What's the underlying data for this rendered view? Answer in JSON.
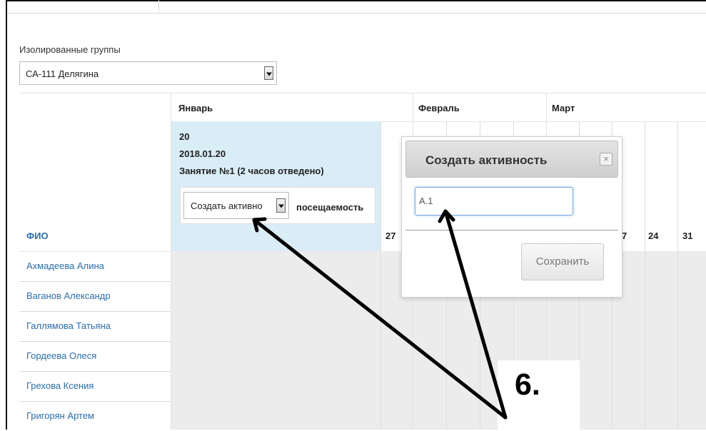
{
  "group_filter": {
    "label": "Изолированные группы",
    "selected": "СА-111 Делягина"
  },
  "table": {
    "months": [
      "Январь",
      "Февраль",
      "Март"
    ],
    "lesson": {
      "day": "20",
      "date": "2018.01.20",
      "title": "Занятие №1 (2 часов отведено)",
      "activity_select": "Создать активно",
      "attendance_label": "посещаемость"
    },
    "days": [
      "27",
      "7",
      "24",
      "31"
    ],
    "fio_header": "ФИО",
    "students": [
      "Ахмадеева Алина",
      "Ваганов Александр",
      "Галлямова Татьяна",
      "Гордеева Олеся",
      "Грехова Ксения",
      "Григорян Артем"
    ]
  },
  "modal": {
    "title": "Создать активность",
    "close": "×",
    "input_value": "А.1",
    "save_label": "Сохранить"
  },
  "callout": {
    "label": "6."
  }
}
